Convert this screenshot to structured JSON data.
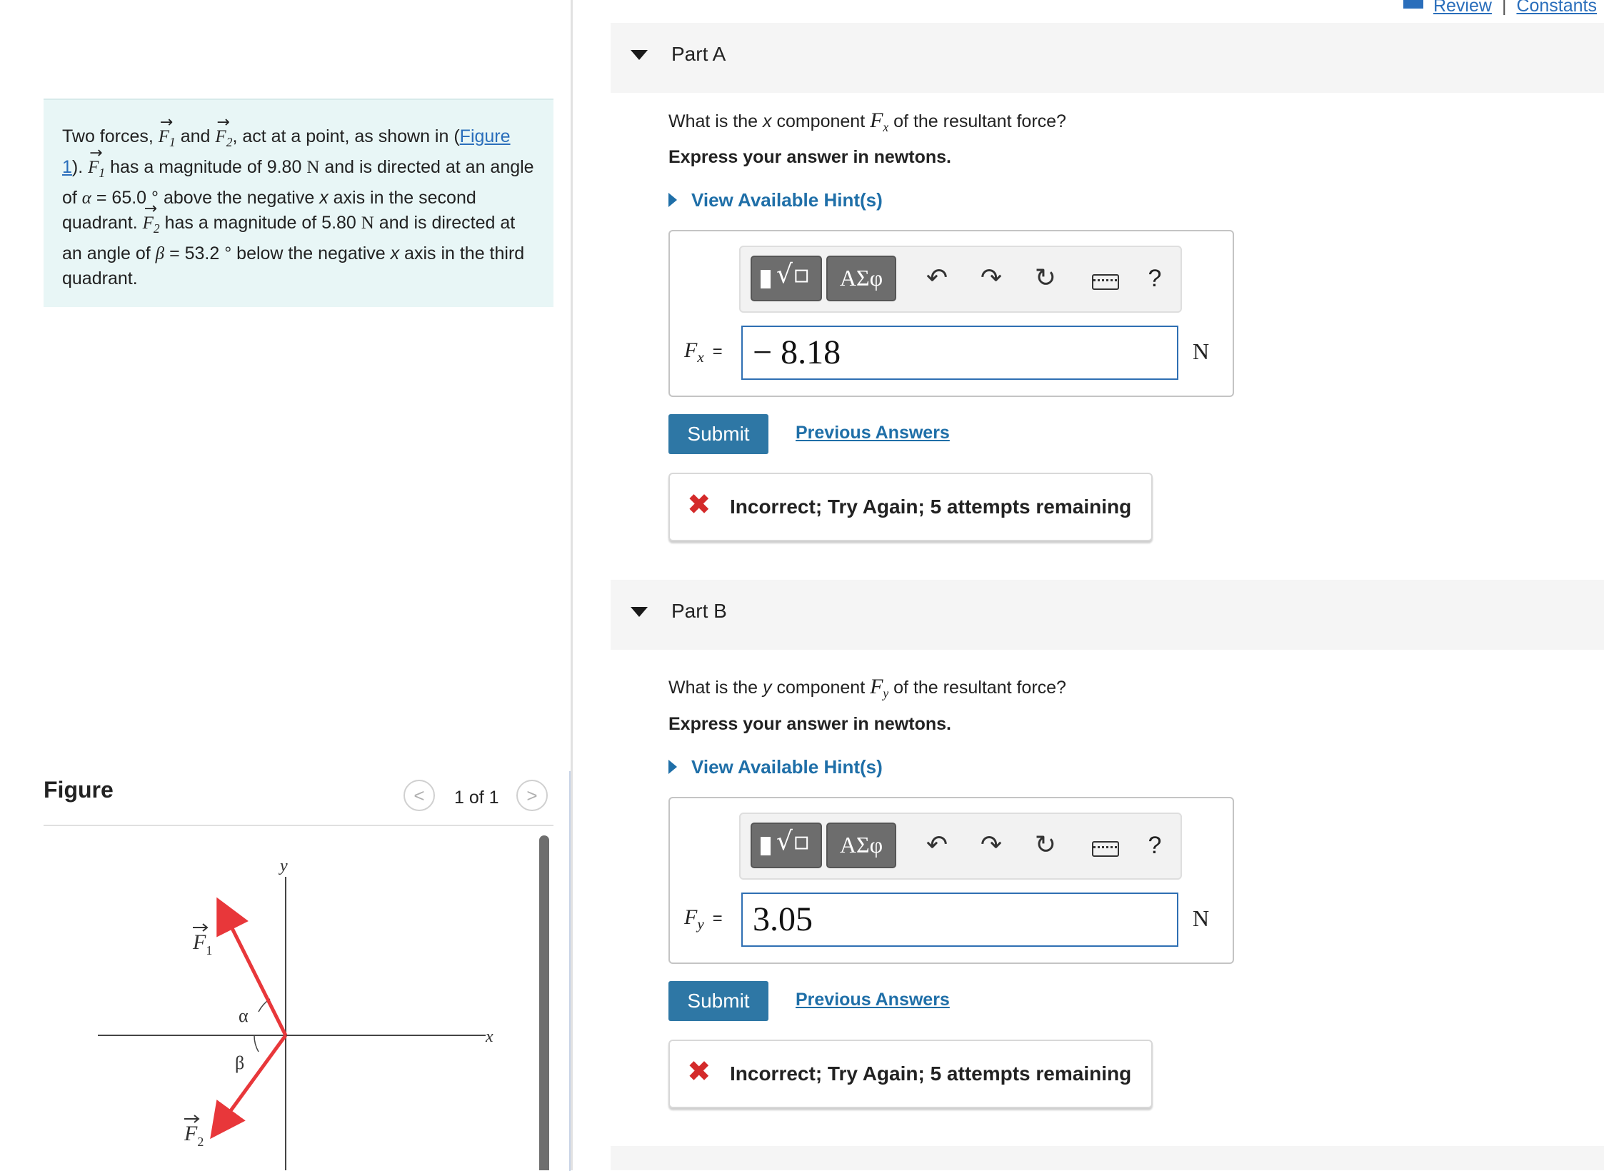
{
  "toplinks": {
    "review": "Review",
    "separator": "|",
    "constants": "Constants"
  },
  "problem": {
    "t1": "Two forces, ",
    "f1": "F",
    "f1sub": "1",
    "and": " and ",
    "f2": "F",
    "f2sub": "2",
    "t2": ", act at a point, as shown in (",
    "figlink": "Figure 1",
    "t3": "). ",
    "t4": " has a magnitude of 9.80 ",
    "unitN": "N",
    "t5": " and is directed at an angle of ",
    "alpha": "α",
    "t6": " = 65.0 ° above the negative ",
    "xvar": "x",
    "t7": " axis in the second quadrant. ",
    "t8": " has a magnitude of 5.80 ",
    "t9": " and is directed at an angle of ",
    "beta": "β",
    "t10": " = 53.2 ° below the negative ",
    "t11": " axis in the third quadrant."
  },
  "figure": {
    "title": "Figure",
    "page": "1 of 1",
    "prev": "<",
    "next": ">",
    "labels": {
      "y": "y",
      "x": "x",
      "f1": "F",
      "f1sub": "1",
      "f2": "F",
      "f2sub": "2",
      "alpha": "α",
      "beta": "β"
    }
  },
  "colors": {
    "force_arrow": "#e8373a",
    "accent": "#2e77a5",
    "link": "#1f6fa8",
    "error": "#d42a2a",
    "problem_bg": "#e8f6f6"
  },
  "partA": {
    "title": "Part A",
    "q_pre": "What is the ",
    "q_var": "x",
    "q_mid": " component ",
    "q_F": "F",
    "q_sub": "x",
    "q_post": " of the resultant force?",
    "express": "Express your answer in newtons.",
    "hint": "View Available Hint(s)",
    "toolbar": {
      "greek": "ΑΣφ",
      "undo": "↶",
      "redo": "↷",
      "reset": "↻",
      "help": "?"
    },
    "label_F": "F",
    "label_sub": "x",
    "eq": "=",
    "value": "− 8.18",
    "unit": "N",
    "submit": "Submit",
    "previous": "Previous Answers",
    "feedback_icon": "✖",
    "feedback": "Incorrect; Try Again; 5 attempts remaining"
  },
  "partB": {
    "title": "Part B",
    "q_pre": "What is the ",
    "q_var": "y",
    "q_mid": " component ",
    "q_F": "F",
    "q_sub": "y",
    "q_post": " of the resultant force?",
    "express": "Express your answer in newtons.",
    "hint": "View Available Hint(s)",
    "toolbar": {
      "greek": "ΑΣφ",
      "undo": "↶",
      "redo": "↷",
      "reset": "↻",
      "help": "?"
    },
    "label_F": "F",
    "label_sub": "y",
    "eq": "=",
    "value": "3.05",
    "unit": "N",
    "submit": "Submit",
    "previous": "Previous Answers",
    "feedback_icon": "✖",
    "feedback": "Incorrect; Try Again; 5 attempts remaining"
  }
}
